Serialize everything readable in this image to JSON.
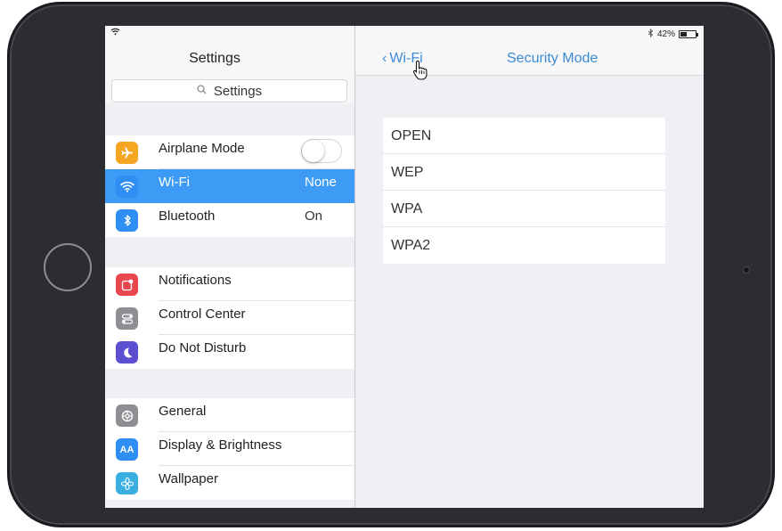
{
  "status_bar": {
    "battery_percent": "42%",
    "battery_level": 0.42,
    "bluetooth_icon": "bluetooth-icon",
    "wifi_icon": "wifi-icon"
  },
  "sidebar": {
    "title": "Settings",
    "search_placeholder": "Settings",
    "groups": [
      {
        "items": [
          {
            "label": "Airplane Mode",
            "icon": "airplane-icon",
            "color": "#f5a623",
            "toggle": false
          },
          {
            "label": "Wi-Fi",
            "value": "None",
            "icon": "wifi-icon",
            "color": "#2f8ef4",
            "selected": true
          },
          {
            "label": "Bluetooth",
            "value": "On",
            "icon": "bluetooth-icon",
            "color": "#2f8ef4"
          }
        ]
      },
      {
        "items": [
          {
            "label": "Notifications",
            "icon": "notifications-icon",
            "color": "#e8474d"
          },
          {
            "label": "Control Center",
            "icon": "control-center-icon",
            "color": "#8e8e93"
          },
          {
            "label": "Do Not Disturb",
            "icon": "moon-icon",
            "color": "#5b4fcf"
          }
        ]
      },
      {
        "items": [
          {
            "label": "General",
            "icon": "gear-icon",
            "color": "#8e8e93"
          },
          {
            "label": "Display & Brightness",
            "icon": "display-icon",
            "color": "#2f8ef4",
            "icon_text": "AA"
          },
          {
            "label": "Wallpaper",
            "icon": "wallpaper-icon",
            "color": "#3aaee0"
          }
        ]
      }
    ]
  },
  "detail": {
    "back_label": "Wi-Fi",
    "title": "Security Mode",
    "options": [
      "OPEN",
      "WEP",
      "WPA",
      "WPA2"
    ]
  },
  "colors": {
    "accent": "#3d8bd6",
    "selected_row": "#3d9bf5"
  }
}
